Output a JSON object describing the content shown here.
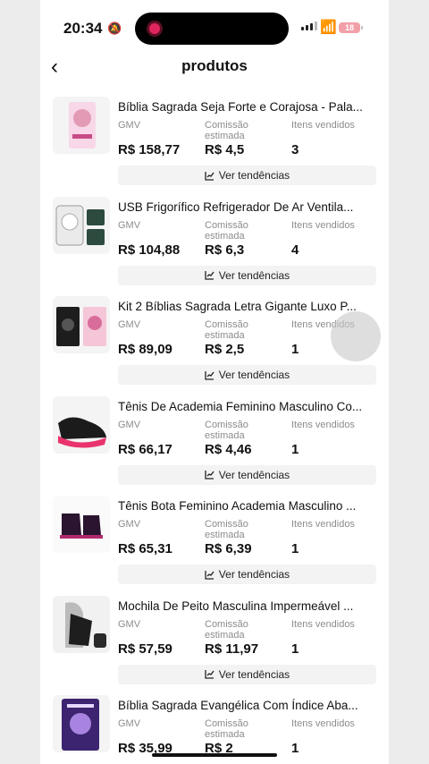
{
  "status_bar": {
    "time": "20:34",
    "battery": "18"
  },
  "header": {
    "title": "produtos"
  },
  "labels": {
    "gmv": "GMV",
    "commission": "Comissão estimada",
    "sold": "Itens vendidos",
    "trend": "Ver tendências"
  },
  "products": [
    {
      "name": "Bíblia Sagrada Seja Forte e Corajosa - Pala...",
      "gmv": "R$ 158,77",
      "commission": "R$ 4,5",
      "sold": "3"
    },
    {
      "name": "USB Frigorífico Refrigerador De Ar Ventila...",
      "gmv": "R$ 104,88",
      "commission": "R$ 6,3",
      "sold": "4"
    },
    {
      "name": "Kit 2 Bíblias Sagrada Letra Gigante Luxo P...",
      "gmv": "R$ 89,09",
      "commission": "R$ 2,5",
      "sold": "1"
    },
    {
      "name": "Tênis De Academia Feminino Masculino Co...",
      "gmv": "R$ 66,17",
      "commission": "R$ 4,46",
      "sold": "1"
    },
    {
      "name": "Tênis Bota Feminino Academia Masculino ...",
      "gmv": "R$ 65,31",
      "commission": "R$ 6,39",
      "sold": "1"
    },
    {
      "name": "Mochila De Peito Masculina Impermeável ...",
      "gmv": "R$ 57,59",
      "commission": "R$ 11,97",
      "sold": "1"
    },
    {
      "name": "Bíblia Sagrada Evangélica Com Índice Aba...",
      "gmv": "R$ 35,99",
      "commission": "R$ 2",
      "sold": "1"
    }
  ]
}
